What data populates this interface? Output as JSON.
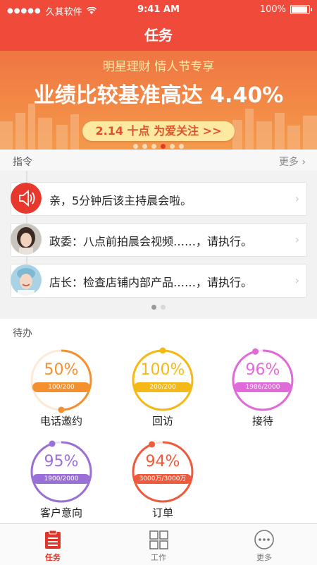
{
  "status_bar": {
    "carrier": "久其软件",
    "time": "9:41 AM",
    "battery": "100%"
  },
  "nav": {
    "title": "任务"
  },
  "banner": {
    "subtitle": "明星理财   情人节专享",
    "headline": "业绩比较基准高达 4.40%",
    "pill": "2.14 十点 为爱关注 >>"
  },
  "commands": {
    "title": "指令",
    "more": "更多",
    "items": [
      {
        "text": "亲，5分钟后该主持晨会啦。",
        "icon": "speaker-icon"
      },
      {
        "text": "政委：八点前拍晨会视频……，请执行。",
        "icon": "avatar-woman"
      },
      {
        "text": "店长：检查店铺内部产品……，请执行。",
        "icon": "avatar-woman-smiling"
      }
    ]
  },
  "todo": {
    "title": "待办",
    "items": [
      {
        "percent": "50%",
        "count": "100/200",
        "label": "电话邀约",
        "progress": 0.5,
        "color": "#f5902e"
      },
      {
        "percent": "100%",
        "count": "200/200",
        "label": "回访",
        "progress": 1.0,
        "color": "#f4b917"
      },
      {
        "percent": "96%",
        "count": "1986/2000",
        "label": "接待",
        "progress": 0.96,
        "color": "#e06ad8"
      },
      {
        "percent": "95%",
        "count": "1900/2000",
        "label": "客户意向",
        "progress": 0.95,
        "color": "#9b6fd8"
      },
      {
        "percent": "94%",
        "count": "3000万/3000万",
        "label": "订单",
        "progress": 0.94,
        "color": "#ef5a3c"
      }
    ]
  },
  "tabs": [
    {
      "label": "任务",
      "icon": "task-list-icon",
      "active": true
    },
    {
      "label": "工作",
      "icon": "grid-icon",
      "active": false
    },
    {
      "label": "更多",
      "icon": "more-dots-icon",
      "active": false
    }
  ],
  "colors": {
    "primary": "#f04a3a",
    "accent": "#e0352a"
  }
}
